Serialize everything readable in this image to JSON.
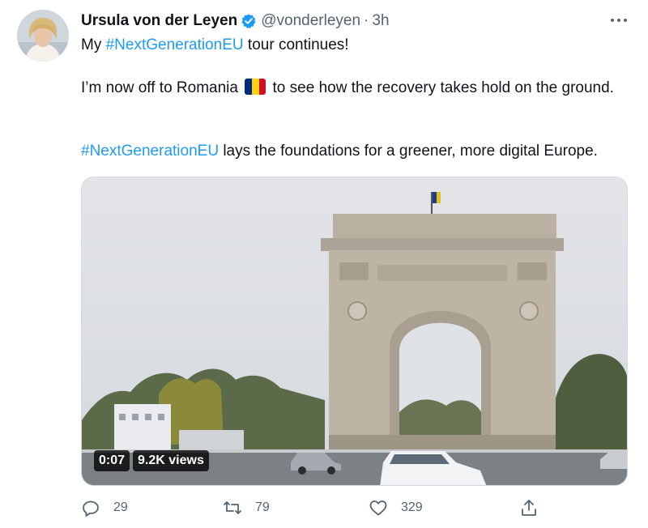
{
  "author": {
    "display_name": "Ursula von der Leyen",
    "handle": "@vonderleyen",
    "separator": "·",
    "time": "3h",
    "verified": true,
    "avatar_icon": "profile-photo"
  },
  "tweet": {
    "line1": {
      "prefix": "My ",
      "hashtag": "#NextGenerationEU",
      "suffix": " tour continues!"
    },
    "line2": {
      "before_flag": "I’m now off to Romania",
      "flag_icon": "romania-flag-emoji",
      "after_flag": "to see how the recovery takes hold on the ground."
    },
    "line3": {
      "hashtag": "#NextGenerationEU",
      "suffix": " lays the foundations for a greener, more digital Europe."
    }
  },
  "video": {
    "duration": "0:07",
    "views": "9.2K views"
  },
  "actions": {
    "reply_count": "29",
    "retweet_count": "79",
    "like_count": "329"
  },
  "colors": {
    "text": "#0f1419",
    "secondary": "#536471",
    "link": "#1d9bf0",
    "verified_badge": "#1d9bf0",
    "flag": [
      "#002B7F",
      "#FCD116",
      "#CE1126"
    ]
  }
}
